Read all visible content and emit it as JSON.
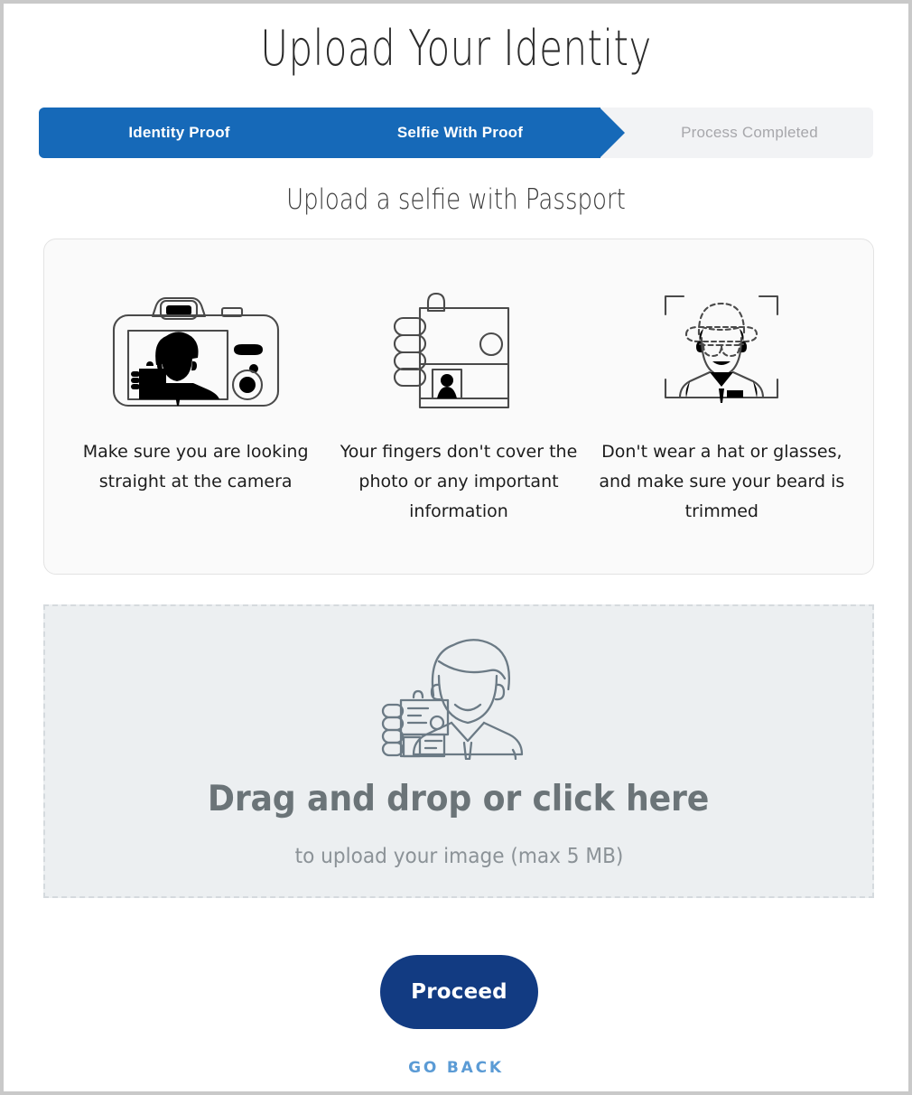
{
  "page": {
    "title": "Upload Your Identity",
    "section_subtitle": "Upload a selfie with Passport"
  },
  "stepper": {
    "steps": [
      {
        "label": "Identity Proof",
        "state": "completed"
      },
      {
        "label": "Selfie With Proof",
        "state": "active"
      },
      {
        "label": "Process Completed",
        "state": "pending"
      }
    ],
    "active_color": "#1669b8",
    "pending_bg": "#f2f3f5",
    "pending_text_color": "#a7a7ab"
  },
  "instructions": {
    "items": [
      {
        "icon": "camera-selfie-icon",
        "text": "Make sure you are looking straight at the camera"
      },
      {
        "icon": "hand-holding-id-card-icon",
        "text": "Your fingers don't cover the photo or any important information"
      },
      {
        "icon": "face-scan-no-hat-glasses-icon",
        "text": "Don't wear a hat or glasses, and make sure your beard is trimmed"
      }
    ]
  },
  "dropzone": {
    "icon": "person-holding-id-icon",
    "title": "Drag and drop or click here",
    "subtitle": "to upload your image (max 5 MB)"
  },
  "actions": {
    "proceed_label": "Proceed",
    "go_back_label": "GO BACK",
    "proceed_color": "#123b82",
    "go_back_color": "#5b9bd5"
  }
}
